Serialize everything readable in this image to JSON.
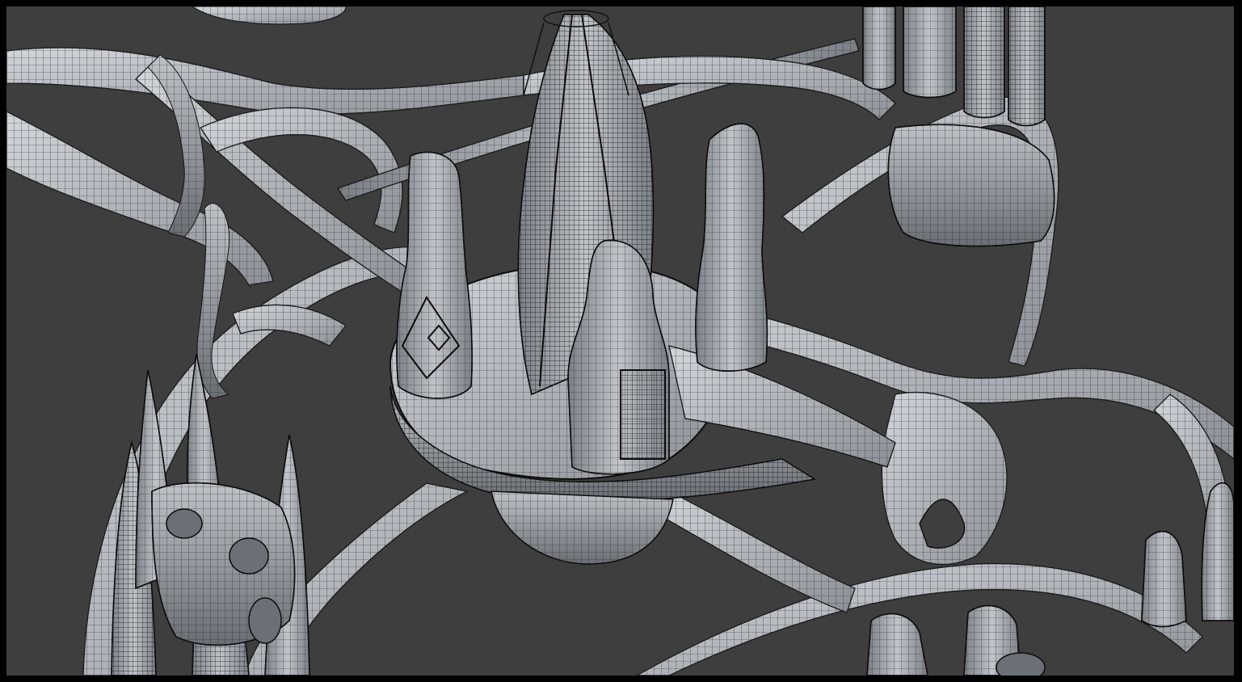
{
  "viewport": {
    "background": "#3e3e3e",
    "frame_color": "#000000",
    "mesh_fill": "#a9adb2",
    "mesh_fill_light": "#c8ccd1",
    "mesh_fill_dark": "#6f7379",
    "wire_color": "#1a1a1a"
  },
  "scene": {
    "subject": "wireframe-3d-sci-fi-structure",
    "icons": [
      "grid-mesh",
      "spire",
      "tower",
      "arch",
      "platform"
    ]
  }
}
